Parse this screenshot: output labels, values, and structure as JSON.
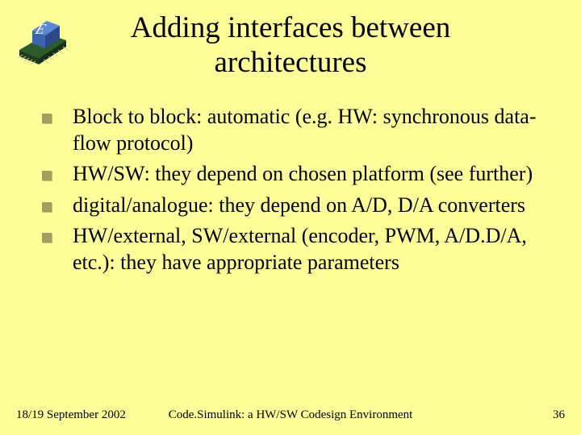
{
  "title": "Adding interfaces between architectures",
  "bullets": [
    "Block to block: automatic (e.g. HW: synchronous data-flow protocol)",
    "HW/SW: they depend on chosen platform (see further)",
    "digital/analogue: they depend on A/D, D/A converters",
    "HW/external, SW/external (encoder, PWM, A/D.D/A, etc.): they have appropriate parameters"
  ],
  "footer": {
    "date": "18/19 September 2002",
    "caption": "Code.Simulink: a HW/SW Codesign Environment",
    "page": "36"
  }
}
